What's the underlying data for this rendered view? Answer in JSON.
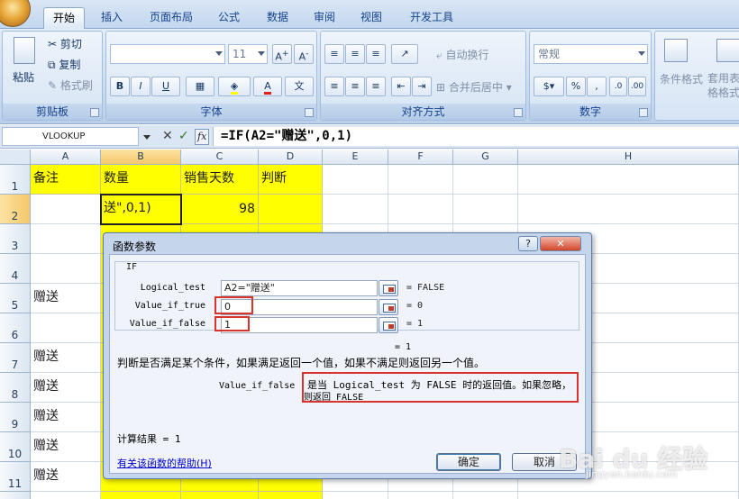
{
  "ribbon_tabs": [
    "开始",
    "插入",
    "页面布局",
    "公式",
    "数据",
    "审阅",
    "视图",
    "开发工具"
  ],
  "clipboard": {
    "paste": "粘贴",
    "cut": "剪切",
    "copy": "复制",
    "format_painter": "格式刷",
    "label": "剪贴板"
  },
  "font": {
    "size": "11",
    "label": "字体",
    "bold": "B",
    "italic": "I",
    "underline": "U"
  },
  "alignment": {
    "wrap_text": "自动换行",
    "merge_center": "合并后居中",
    "label": "对齐方式"
  },
  "number": {
    "format": "常规",
    "percent": "%",
    "comma": ",",
    "label": "数字"
  },
  "styles": {
    "conditional_format": "条件格式",
    "format_as_table": "套用表格格式"
  },
  "formula_bar": {
    "name_box": "VLOOKUP",
    "cancel": "✕",
    "enter": "✓",
    "fx": "fx",
    "formula": "=IF(A2=\"赠送\",0,1)"
  },
  "columns": [
    "A",
    "B",
    "C",
    "D",
    "E",
    "F",
    "G",
    "H"
  ],
  "rows": [
    "1",
    "2",
    "3",
    "4",
    "5",
    "6",
    "7",
    "8",
    "9",
    "10",
    "11"
  ],
  "cells": {
    "A1": "备注",
    "B1": "数量",
    "C1": "销售天数",
    "D1": "判断",
    "B2": "送\",0,1)",
    "C2": "98",
    "A5": "赠送",
    "A7": "赠送",
    "A8": "赠送",
    "A9": "赠送",
    "A10": "赠送",
    "A11": "赠送"
  },
  "dialog": {
    "title": "函数参数",
    "help_btn": "?",
    "close_btn": "✕",
    "function_name": "IF",
    "args": [
      {
        "label": "Logical_test",
        "value": "A2=\"赠送\"",
        "result": "= FALSE"
      },
      {
        "label": "Value_if_true",
        "value": "0",
        "result": "= 0"
      },
      {
        "label": "Value_if_false",
        "value": "1",
        "result": "= 1"
      }
    ],
    "overall_result": "= 1",
    "description": "判断是否满足某个条件，如果满足返回一个值，如果不满足则返回另一个值。",
    "param_name": "Value_if_false",
    "param_desc_line1": "是当 Logical_test 为 FALSE 时的返回值。如果忽略，",
    "param_desc_line2": "则返回 FALSE",
    "calc_result": "计算结果 = 1",
    "help_link": "有关该函数的帮助(H)",
    "ok": "确定",
    "cancel": "取消"
  },
  "watermark": {
    "brand": "Bai du 经验",
    "url": "jingyan.baidu.com"
  }
}
